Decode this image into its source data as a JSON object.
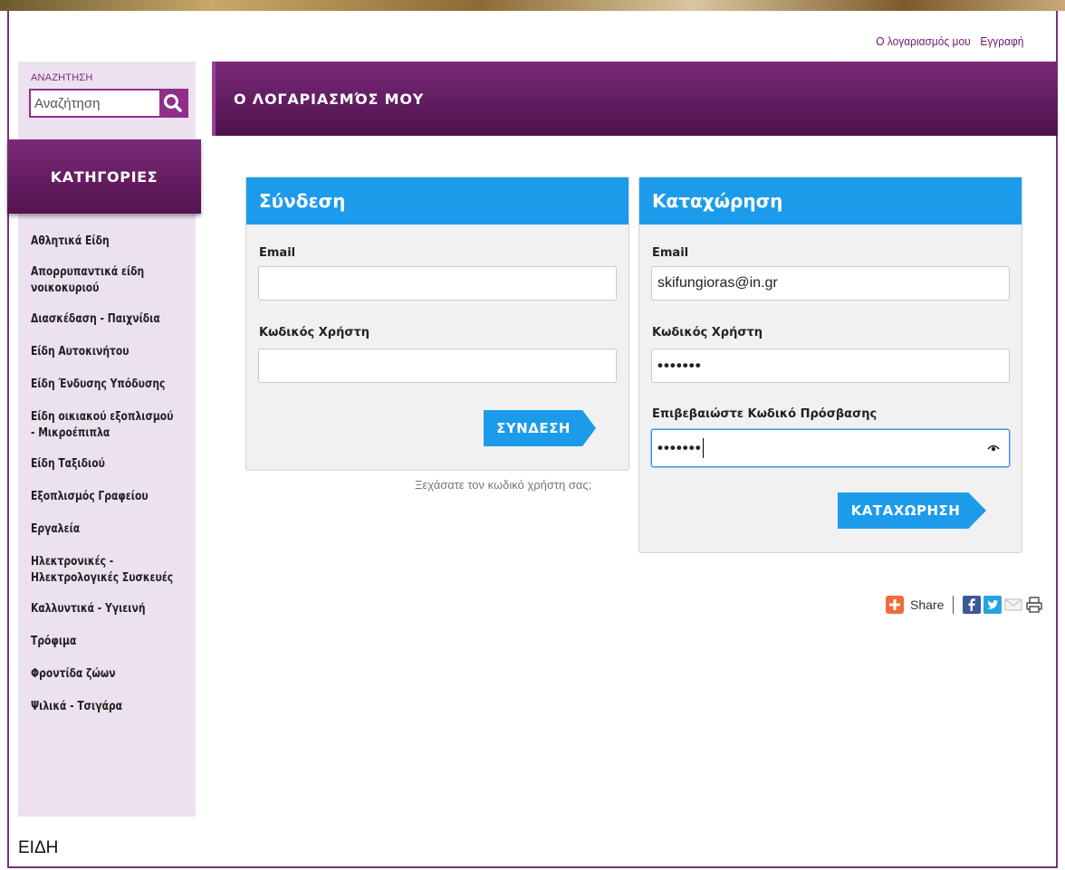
{
  "header": {
    "my_account_link": "Ο λογαριασμός μου",
    "register_link": "Εγγραφή"
  },
  "sidebar": {
    "search_caption": "ΑΝΑΖΗΤΗΣΗ",
    "search_placeholder": "Αναζήτηση",
    "categories_title": "ΚΑΤΗΓΟΡΙΕΣ",
    "categories": [
      "Αθλητικά Είδη",
      "Απορρυπαντικά είδη νοικοκυριού",
      "Διασκέδαση - Παιχνίδια",
      "Είδη Αυτοκινήτου",
      "Είδη Ένδυσης Υπόδυσης",
      "Είδη οικιακού εξοπλισμού - Μικροέπιπλα",
      "Είδη Ταξιδιού",
      "Εξοπλισμός Γραφείου",
      "Εργαλεία",
      "Ηλεκτρονικές - Ηλεκτρολογικές Συσκευές",
      "Καλλυντικά - Υγιεινή",
      "Τρόφιμα",
      "Φροντίδα ζώων",
      "Ψιλικά - Τσιγάρα"
    ],
    "bottom_label": "ΕΙΔΗ"
  },
  "main": {
    "page_title": "Ο ΛΟΓΑΡΙΑΣΜΌΣ ΜΟΥ",
    "login": {
      "title": "Σύνδεση",
      "email_label": "Email",
      "email_value": "",
      "password_label": "Κωδικός Χρήστη",
      "password_value": "",
      "submit_label": "ΣΥΝΔΕΣΗ",
      "forgot_link": "Ξεχάσατε τον κωδικό χρήστη σας;"
    },
    "register": {
      "title": "Καταχώρηση",
      "email_label": "Email",
      "email_value": "skifungioras@in.gr",
      "password_label": "Κωδικός Χρήστη",
      "password_dots": "•••••••",
      "confirm_label": "Επιβεβαιώστε Κωδικό Πρόσβασης",
      "confirm_dots": "•••••••",
      "submit_label": "ΚΑΤΑΧΩΡΗΣΗ"
    }
  },
  "share": {
    "label": "Share",
    "icons": [
      "share-plus-icon",
      "facebook-icon",
      "twitter-icon",
      "email-icon",
      "print-icon"
    ]
  },
  "colors": {
    "brand_purple": "#6d1a6b",
    "accent_blue": "#1c9bea",
    "sidebar_bg": "#ece1ee"
  }
}
